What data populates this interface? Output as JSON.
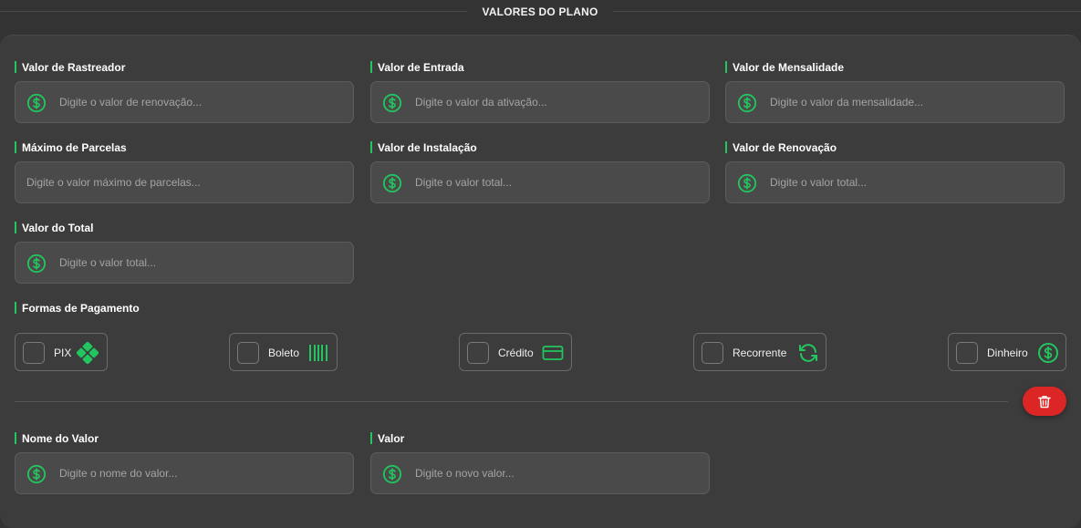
{
  "section": {
    "title": "VALORES DO PLANO"
  },
  "fields": [
    {
      "label": "Valor de Rastreador",
      "placeholder": "Digite o valor de renovação...",
      "icon": "dollar-icon"
    },
    {
      "label": "Valor de Entrada",
      "placeholder": "Digite o valor da ativação...",
      "icon": "dollar-icon"
    },
    {
      "label": "Valor de Mensalidade",
      "placeholder": "Digite o valor da mensalidade...",
      "icon": "dollar-icon"
    },
    {
      "label": "Máximo de Parcelas",
      "placeholder": "Digite o valor máximo de parcelas...",
      "icon": ""
    },
    {
      "label": "Valor de Instalação",
      "placeholder": "Digite o valor total...",
      "icon": "dollar-icon"
    },
    {
      "label": "Valor de Renovação",
      "placeholder": "Digite o valor total...",
      "icon": "dollar-icon"
    },
    {
      "label": "Valor do Total",
      "placeholder": "Digite o valor total...",
      "icon": "dollar-icon"
    }
  ],
  "payments": {
    "label": "Formas de Pagamento",
    "options": [
      {
        "label": "PIX",
        "icon": "pix-icon",
        "checked": false
      },
      {
        "label": "Boleto",
        "icon": "barcode-icon",
        "checked": false
      },
      {
        "label": "Crédito",
        "icon": "credit-card-icon",
        "checked": false
      },
      {
        "label": "Recorrente",
        "icon": "refresh-icon",
        "checked": false
      },
      {
        "label": "Dinheiro",
        "icon": "dollar-icon",
        "checked": false
      }
    ]
  },
  "custom_value": {
    "name_label": "Nome do Valor",
    "name_placeholder": "Digite o nome do valor...",
    "value_label": "Valor",
    "value_placeholder": "Digite o novo valor..."
  },
  "colors": {
    "accent": "#22c55e",
    "danger": "#dc2626",
    "background": "#333333",
    "panel": "#3c3c3c",
    "input": "#4a4a4a"
  }
}
